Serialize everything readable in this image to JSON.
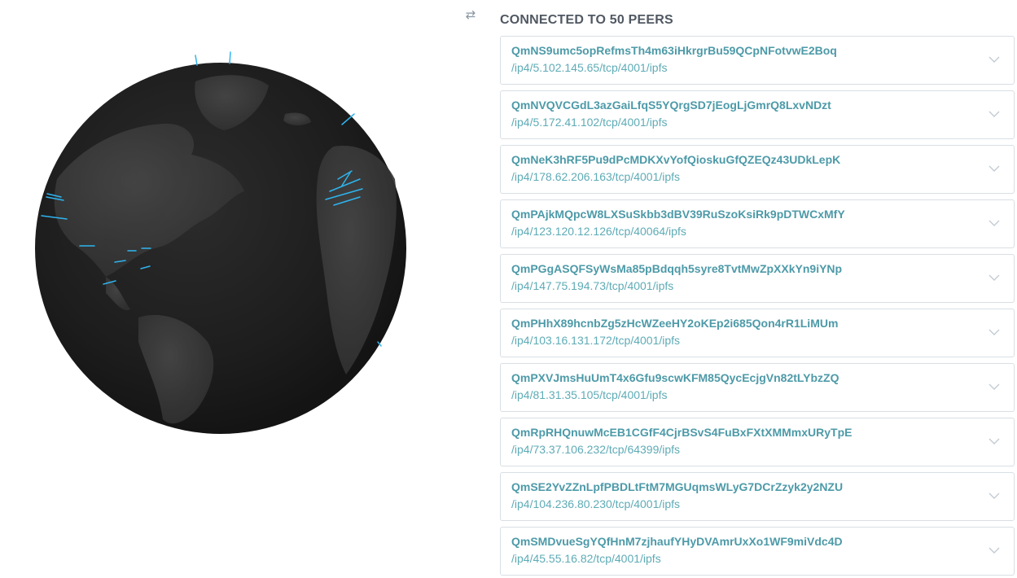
{
  "header": {
    "swap_icon": "exchange-arrows-icon",
    "title": "CONNECTED TO 50 PEERS"
  },
  "globe": {
    "description_icon": "globe-icon",
    "connection_color": "#2eb5f0",
    "globe_color": "#1f1f1f"
  },
  "colors": {
    "peer_id": "#4d9aa8",
    "peer_address": "#5eabb6",
    "title": "#505862",
    "border": "#d9dfe4"
  },
  "peers": [
    {
      "id": "QmNS9umc5opRefmsTh4m63iHkrgrBu59QCpNFotvwE2Boq",
      "address": "/ip4/5.102.145.65/tcp/4001/ipfs"
    },
    {
      "id": "QmNVQVCGdL3azGaiLfqS5YQrgSD7jEogLjGmrQ8LxvNDzt",
      "address": "/ip4/5.172.41.102/tcp/4001/ipfs"
    },
    {
      "id": "QmNeK3hRF5Pu9dPcMDKXvYofQioskuGfQZEQz43UDkLepK",
      "address": "/ip4/178.62.206.163/tcp/4001/ipfs"
    },
    {
      "id": "QmPAjkMQpcW8LXSuSkbb3dBV39RuSzoKsiRk9pDTWCxMfY",
      "address": "/ip4/123.120.12.126/tcp/40064/ipfs"
    },
    {
      "id": "QmPGgASQFSyWsMa85pBdqqh5syre8TvtMwZpXXkYn9iYNp",
      "address": "/ip4/147.75.194.73/tcp/4001/ipfs"
    },
    {
      "id": "QmPHhX89hcnbZg5zHcWZeeHY2oKEp2i685Qon4rR1LiMUm",
      "address": "/ip4/103.16.131.172/tcp/4001/ipfs"
    },
    {
      "id": "QmPXVJmsHuUmT4x6Gfu9scwKFM85QycEcjgVn82tLYbzZQ",
      "address": "/ip4/81.31.35.105/tcp/4001/ipfs"
    },
    {
      "id": "QmRpRHQnuwMcEB1CGfF4CjrBSvS4FuBxFXtXMMmxURyTpE",
      "address": "/ip4/73.37.106.232/tcp/64399/ipfs"
    },
    {
      "id": "QmSE2YvZZnLpfPBDLtFtM7MGUqmsWLyG7DCrZzyk2y2NZU",
      "address": "/ip4/104.236.80.230/tcp/4001/ipfs"
    },
    {
      "id": "QmSMDvueSgYQfHnM7zjhaufYHyDVAmrUxXo1WF9miVdc4D",
      "address": "/ip4/45.55.16.82/tcp/4001/ipfs"
    }
  ]
}
